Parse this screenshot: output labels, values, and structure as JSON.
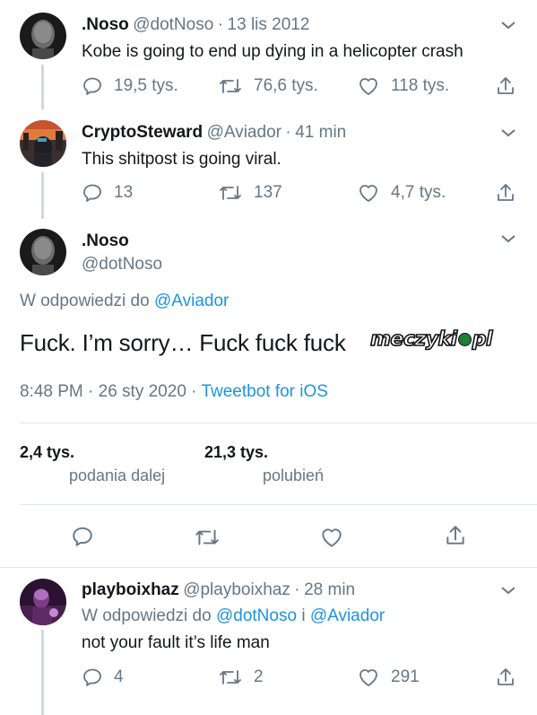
{
  "tweet1": {
    "name": ".Noso",
    "handle": "@dotNoso",
    "date": "13 lis 2012",
    "text": "Kobe is going to end up dying in a helicopter crash",
    "replies": "19,5 tys.",
    "retweets": "76,6 tys.",
    "likes": "118 tys."
  },
  "tweet2": {
    "name": "CryptoSteward",
    "handle": "@Aviador",
    "date": "41 min",
    "text": "This shitpost is going viral.",
    "replies": "13",
    "retweets": "137",
    "likes": "4,7 tys."
  },
  "main_tweet": {
    "name": ".Noso",
    "handle": "@dotNoso",
    "reply_prefix": "W odpowiedzi do",
    "reply_to": "@Aviador",
    "text": "Fuck. I’m sorry… Fuck fuck fuck",
    "time": "8:48 PM · 26 sty 2020 ·",
    "client": "Tweetbot for iOS",
    "retweets_count": "2,4 tys.",
    "retweets_label": "podania dalej",
    "likes_count": "21,3 tys.",
    "likes_label": "polubień"
  },
  "tweet4": {
    "name": "playboixhaz",
    "handle": "@playboixhaz",
    "date": "28 min",
    "reply_prefix": "W odpowiedzi do",
    "reply_to_1": "@dotNoso",
    "reply_joiner": "i",
    "reply_to_2": "@Aviador",
    "text": "not your fault it’s life man",
    "replies": "4",
    "retweets": "2",
    "likes": "291"
  },
  "watermark": "meczyki.pl",
  "separator": "·",
  "icons": [
    "reply-icon",
    "retweet-icon",
    "like-icon",
    "share-icon",
    "chevron-down-icon"
  ],
  "colors": {
    "link": "#1b95e0",
    "muted": "#657786",
    "text": "#14171a"
  }
}
